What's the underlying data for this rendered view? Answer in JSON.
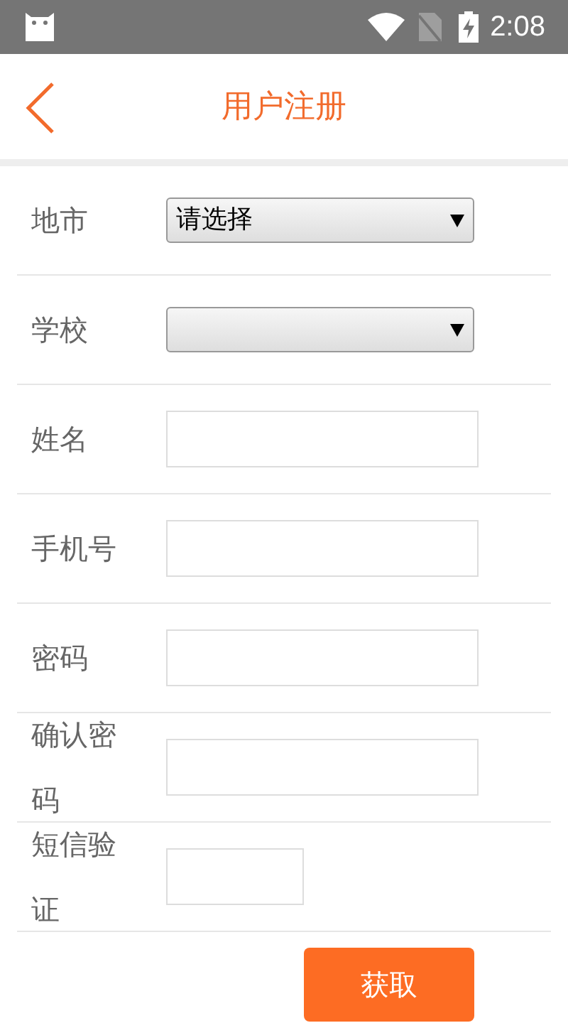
{
  "status_bar": {
    "time": "2:08"
  },
  "header": {
    "title": "用户注册"
  },
  "form": [
    {
      "kind": "select",
      "label": "地市",
      "value": "请选择"
    },
    {
      "kind": "select",
      "label": "学校"
    },
    {
      "kind": "input",
      "label": "姓名"
    },
    {
      "kind": "input",
      "label": "手机号"
    },
    {
      "kind": "input",
      "label": "密码"
    },
    {
      "kind": "input",
      "label": "确认密码"
    },
    {
      "kind": "code",
      "label": "短信验证"
    }
  ],
  "get_code_button": "获取"
}
